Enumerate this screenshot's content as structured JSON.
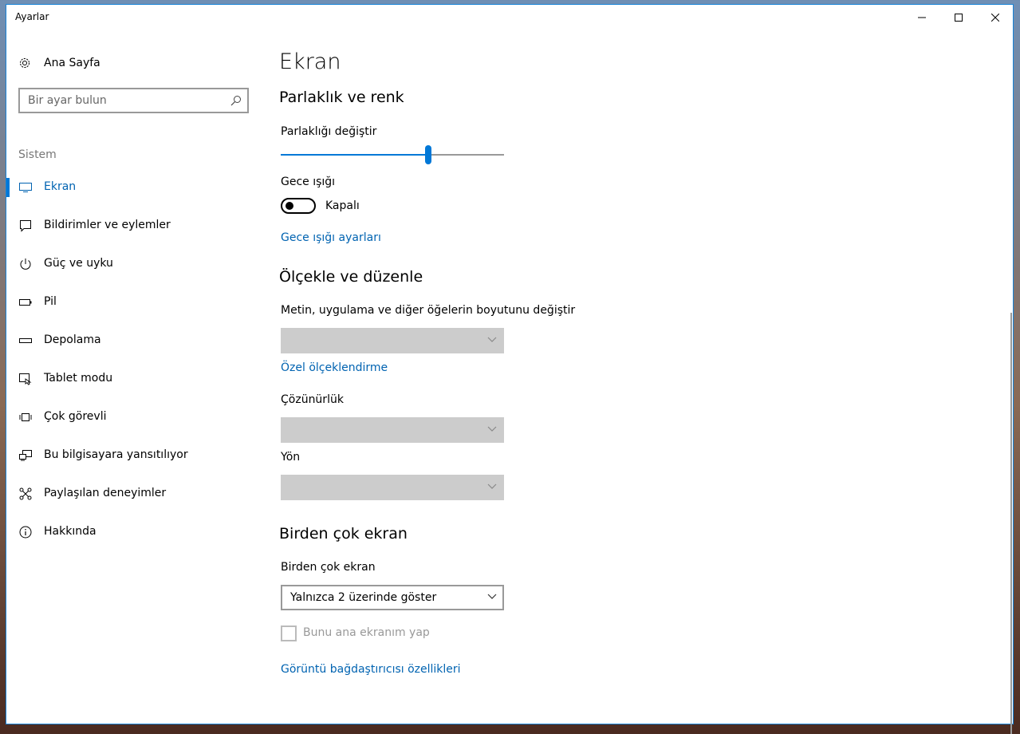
{
  "window": {
    "title": "Ayarlar"
  },
  "sidebar": {
    "home_label": "Ana Sayfa",
    "search_placeholder": "Bir ayar bulun",
    "section_label": "Sistem",
    "items": [
      {
        "label": "Ekran",
        "icon": "monitor-icon",
        "active": true
      },
      {
        "label": "Bildirimler ve eylemler",
        "icon": "notification-icon",
        "active": false
      },
      {
        "label": "Güç ve uyku",
        "icon": "power-icon",
        "active": false
      },
      {
        "label": "Pil",
        "icon": "battery-icon",
        "active": false
      },
      {
        "label": "Depolama",
        "icon": "storage-icon",
        "active": false
      },
      {
        "label": "Tablet modu",
        "icon": "tablet-mode-icon",
        "active": false
      },
      {
        "label": "Çok görevli",
        "icon": "multitasking-icon",
        "active": false
      },
      {
        "label": "Bu bilgisayara yansıtılıyor",
        "icon": "projecting-icon",
        "active": false
      },
      {
        "label": "Paylaşılan deneyimler",
        "icon": "shared-experiences-icon",
        "active": false
      },
      {
        "label": "Hakkında",
        "icon": "info-icon",
        "active": false
      }
    ]
  },
  "main": {
    "title": "Ekran",
    "brightness": {
      "heading": "Parlaklık ve renk",
      "label": "Parlaklığı değiştir",
      "value_percent": 66,
      "night_light_label": "Gece ışığı",
      "night_light_state": "Kapalı",
      "night_light_link": "Gece ışığı ayarları"
    },
    "scale": {
      "heading": "Ölçekle ve düzenle",
      "size_label": "Metin, uygulama ve diğer öğelerin boyutunu değiştir",
      "custom_link": "Özel ölçeklendirme",
      "resolution_label": "Çözünürlük",
      "orientation_label": "Yön"
    },
    "multi": {
      "heading": "Birden çok ekran",
      "label": "Birden çok ekran",
      "selected": "Yalnızca 2 üzerinde göster",
      "checkbox_label": "Bunu ana ekranım yap",
      "adapter_link": "Görüntü bağdaştırıcısı özellikleri"
    }
  },
  "colors": {
    "accent": "#0078d7",
    "link": "#0063b1"
  }
}
